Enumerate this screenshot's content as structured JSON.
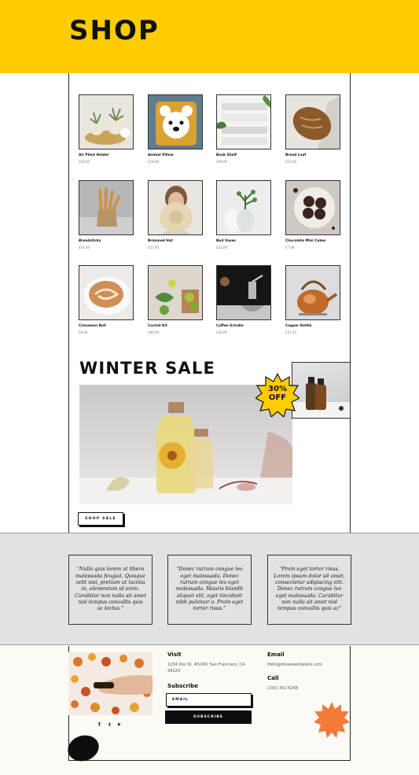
{
  "header": {
    "title": "SHOP"
  },
  "products": [
    {
      "name": "Air Plant Holder",
      "price": "£16.00"
    },
    {
      "name": "Animal Pillow",
      "price": "£18.00"
    },
    {
      "name": "Book Shelf",
      "price": "£99.00"
    },
    {
      "name": "Bread Loaf",
      "price": "£12.00"
    },
    {
      "name": "Breadsticks",
      "price": "£14.00"
    },
    {
      "name": "Brimmed Hat",
      "price": "£25.00"
    },
    {
      "name": "Bud Vases",
      "price": "£22.00"
    },
    {
      "name": "Chocolate Mini Cakes",
      "price": "£7.00"
    },
    {
      "name": "Cinnamon Roll",
      "price": "£8.00"
    },
    {
      "name": "Coctail Kit",
      "price": "£60.00"
    },
    {
      "name": "Coffee Grinder",
      "price": "£30.00"
    },
    {
      "name": "Copper Kettle",
      "price": "£37.00"
    }
  ],
  "sale": {
    "title": "WINTER SALE",
    "badge_line1": "30%",
    "badge_line2": "OFF",
    "button_label": "SHOP SALE"
  },
  "testimonials": [
    {
      "quote": "“Nulla quis lorem ut libero malesuada feugiat. Quisque velit nisi, pretium ut lacinia in, elementum id enim. Curabitur non nulla sit amet nisl tempus convallis quis ac lectus.”"
    },
    {
      "quote": "“Donec rutrum congue leo eget malesuada. Donec rutrum congue leo eget malesuada. Mauris blandit aliquet elit, eget tincidunt nibh pulvinar a. Proin eget tortor risus.”"
    },
    {
      "quote": "“Proin eget tortor risus. Lorem ipsum dolor sit amet, consectetur adipiscing elit. Donec rutrum congue leo eget malesuada. Curabitur non nulla sit amet nisl tempus convallis quis ac”"
    }
  ],
  "footer": {
    "visit_heading": "Visit",
    "address": "1234 Divi St. #1000, San Francisco, CA 94220",
    "subscribe_heading": "Subscribe",
    "email_placeholder": "EMAIL",
    "subscribe_button": "SUBSCRIBE",
    "email_heading": "Email",
    "email_value": "Hello@diviessentialoils.com",
    "call_heading": "Call",
    "phone": "(255) 352-6258",
    "social_facebook": "f",
    "social_twitter": "t",
    "social_youtube": "▶"
  },
  "colors": {
    "accent": "#ffcc00",
    "starburst": "#f47a3a"
  }
}
